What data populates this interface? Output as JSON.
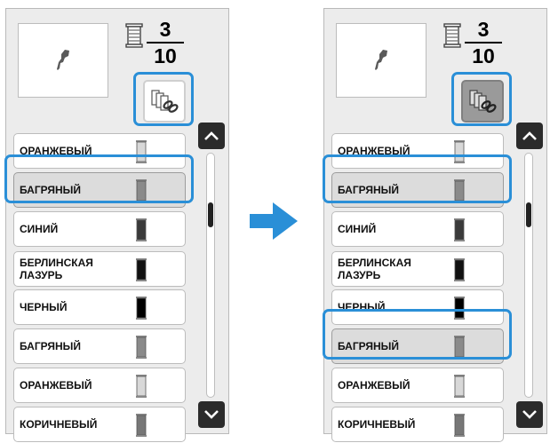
{
  "colors": {
    "accent": "#2a8fd7",
    "button": "#2b2b2b"
  },
  "counter": {
    "current": "3",
    "total": "10"
  },
  "icons": {
    "preview": "embroidery-thread-preview-icon",
    "spool": "thread-spool-icon",
    "link": "thread-link-icon",
    "up": "chevron-up-icon",
    "down": "chevron-down-icon",
    "arrow": "right-arrow-icon"
  },
  "scroll": {
    "position": 0.22
  },
  "left_panel": {
    "link_pressed": false,
    "items": [
      {
        "label": "ОРАНЖЕВЫЙ",
        "color": "#d8d8d8"
      },
      {
        "label": "БАГРЯНЫЙ",
        "color": "#8a8a8a"
      },
      {
        "label": "СИНИЙ",
        "color": "#3a3a3a"
      },
      {
        "label": "БЕРЛИНСКАЯ\nЛАЗУРЬ",
        "color": "#111111"
      },
      {
        "label": "ЧЕРНЫЙ",
        "color": "#000000"
      },
      {
        "label": "БАГРЯНЫЙ",
        "color": "#8a8a8a"
      },
      {
        "label": "ОРАНЖЕВЫЙ",
        "color": "#d8d8d8"
      },
      {
        "label": "КОРИЧНЕВЫЙ",
        "color": "#777777"
      }
    ]
  },
  "right_panel": {
    "link_pressed": true,
    "items": [
      {
        "label": "ОРАНЖЕВЫЙ",
        "color": "#d8d8d8"
      },
      {
        "label": "БАГРЯНЫЙ",
        "color": "#8a8a8a"
      },
      {
        "label": "СИНИЙ",
        "color": "#3a3a3a"
      },
      {
        "label": "БЕРЛИНСКАЯ\nЛАЗУРЬ",
        "color": "#111111"
      },
      {
        "label": "ЧЕРНЫЙ",
        "color": "#000000"
      },
      {
        "label": "БАГРЯНЫЙ",
        "color": "#8a8a8a"
      },
      {
        "label": "ОРАНЖЕВЫЙ",
        "color": "#d8d8d8"
      },
      {
        "label": "КОРИЧНЕВЫЙ",
        "color": "#777777"
      }
    ]
  }
}
